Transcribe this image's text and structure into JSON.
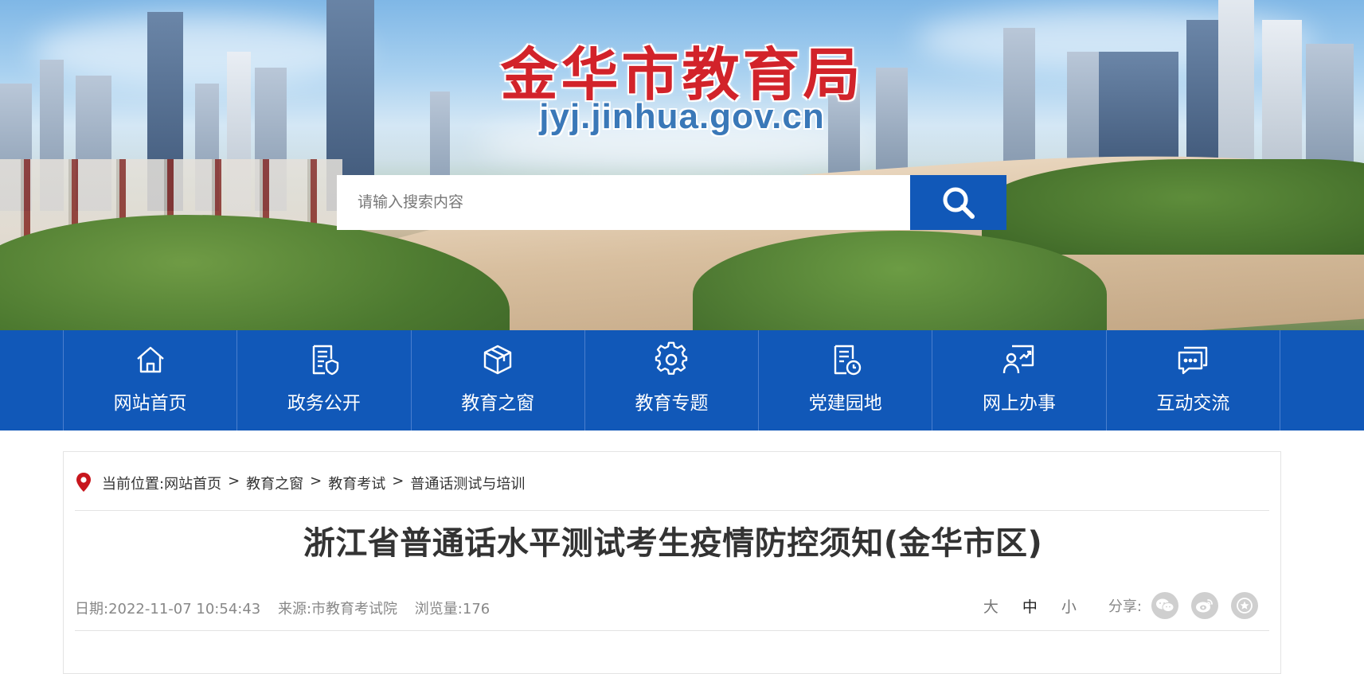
{
  "header": {
    "site_title": "金华市教育局",
    "site_domain": "jyj.jinhua.gov.cn"
  },
  "search": {
    "placeholder": "请输入搜索内容",
    "button_icon": "search-icon"
  },
  "nav": {
    "items": [
      {
        "label": "网站首页",
        "icon": "home-icon"
      },
      {
        "label": "政务公开",
        "icon": "document-shield-icon"
      },
      {
        "label": "教育之窗",
        "icon": "cube-icon"
      },
      {
        "label": "教育专题",
        "icon": "gear-icon"
      },
      {
        "label": "党建园地",
        "icon": "document-clock-icon"
      },
      {
        "label": "网上办事",
        "icon": "person-chart-icon"
      },
      {
        "label": "互动交流",
        "icon": "chat-icon"
      }
    ]
  },
  "breadcrumb": {
    "prefix": "当前位置:",
    "items": [
      "网站首页",
      "教育之窗",
      "教育考试",
      "普通话测试与培训"
    ]
  },
  "article": {
    "title": "浙江省普通话水平测试考生疫情防控须知(金华市区)",
    "date": "日期:2022-11-07 10:54:43",
    "source": "来源:市教育考试院",
    "views": "浏览量:176"
  },
  "font_size": {
    "large": "大",
    "medium": "中",
    "small": "小"
  },
  "share": {
    "label": "分享:",
    "icons": [
      "wechat-icon",
      "weibo-icon",
      "favorite-star-icon"
    ]
  },
  "colors": {
    "brand_blue": "#1158b8",
    "title_red": "#d2232a",
    "location_pin_red": "#c8161d"
  }
}
